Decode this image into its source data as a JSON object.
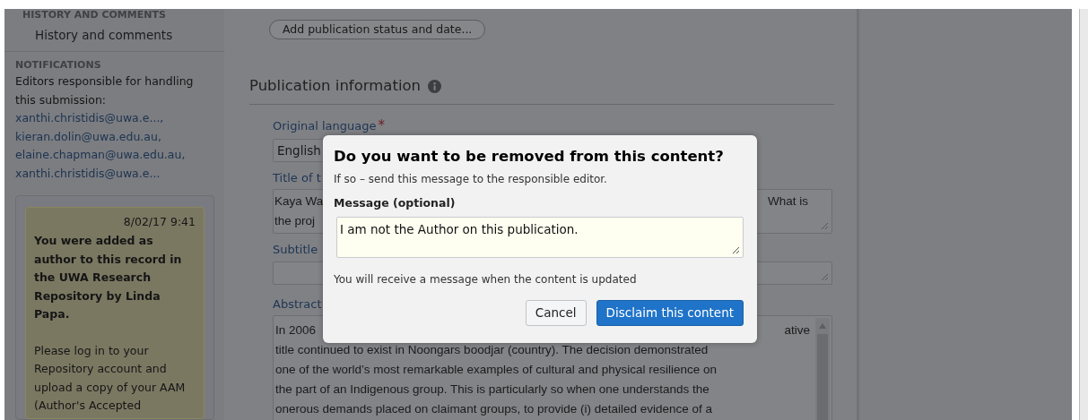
{
  "sidebar": {
    "history": {
      "heading": "HISTORY AND COMMENTS",
      "link": "History and comments"
    },
    "notifications": {
      "heading": "NOTIFICATIONS",
      "intro": "Editors responsible for handling this submission:",
      "editors": [
        "xanthi.christidis@uwa.e...,",
        "kieran.dolin@uwa.edu.au,",
        "elaine.chapman@uwa.edu.au,",
        "xanthi.christidis@uwa.e..."
      ]
    },
    "message": {
      "time": "8/02/17 9:41",
      "title": "You were added as author to this record in the UWA Research Repository by Linda Papa.",
      "body": "Please log in to your Repository account and upload a copy of your AAM (Author's Accepted"
    }
  },
  "main": {
    "status_button": "Add publication status and date...",
    "section_title": "Publication information",
    "language": {
      "label": "Original language",
      "required": true,
      "required_mark": "*",
      "value": "English"
    },
    "title": {
      "label": "Title of t",
      "lines": [
        {
          "left": "Kaya Wa",
          "right": "What is"
        },
        {
          "left": "the proj"
        }
      ]
    },
    "subtitle": {
      "label": "Subtitle"
    },
    "abstract": {
      "label": "Abstract",
      "lines": [
        {
          "left": "In 2006",
          "right": "ative"
        },
        {
          "left": "title continued to exist in Noongars boodjar (country). The decision demonstrated"
        },
        {
          "left": "one of the world’s most remarkable examples of cultural and physical resilience on"
        },
        {
          "left": "the part of an Indigenous group. This is particularly so when one understands the"
        },
        {
          "left": "onerous demands placed on claimant groups, to provide (i) detailed evidence of a"
        }
      ]
    }
  },
  "dialog": {
    "title": "Do you want to be removed from this content?",
    "subtitle": "If so – send this message to the responsible editor.",
    "message_label": "Message (optional)",
    "message_value": "I am not the Author on this publication.",
    "note": "You will receive a message when the content is updated",
    "buttons": [
      {
        "label": "Cancel",
        "kind": "secondary"
      },
      {
        "label": "Disclaim this content",
        "kind": "primary"
      }
    ]
  }
}
